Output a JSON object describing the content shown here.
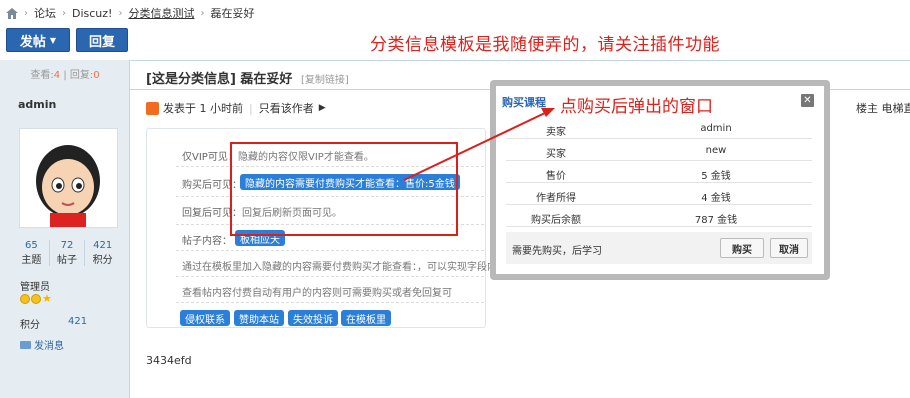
{
  "breadcrumb": {
    "items": [
      "论坛",
      "Discuz!",
      "分类信息测试",
      "磊在妥好"
    ]
  },
  "toolbar": {
    "post_label": "发帖",
    "reply_label": "回复"
  },
  "annotation_top": "分类信息模板是我随便弄的，请关注插件功能",
  "thread": {
    "views_label": "查看:",
    "views": "4",
    "sep": "|",
    "replies_label": "回复:",
    "replies": "0",
    "category": "[这是分类信息]",
    "title": "磊在妥好",
    "copy_link": "[复制链接]"
  },
  "author": {
    "name": "admin",
    "stats": [
      {
        "value": "65",
        "label": "主题"
      },
      {
        "value": "72",
        "label": "帖子"
      },
      {
        "value": "421",
        "label": "积分"
      }
    ],
    "role": "管理员",
    "points_label": "积分",
    "points_value": "421",
    "send_message": "发消息"
  },
  "post": {
    "posted": "发表于 1 小时前",
    "only_author": "只看该作者",
    "floor_right": "楼主 电梯直"
  },
  "infobox": {
    "vip_label": "仅VIP可见：",
    "vip_text": "隐藏的内容仅限VIP才能查看。",
    "buy_label": "购买后可见：",
    "buy_text": "隐藏的内容需要付费购买才能查看：售价:5金钱",
    "reply_label": "回复后可见：",
    "reply_text": "回复后刷新页面可见。",
    "content_label": "帖子内容：",
    "content_pill": "板相应天",
    "desc1": "通过在模板里加入隐藏的内容需要付费购买才能查看：，可以实现字段内",
    "desc2": "查看帖内容付费自动有用户的内容则可需要购买或者免回复可",
    "buttons": [
      "侵权联系",
      "赞助本站",
      "失效投诉",
      "在模板里"
    ]
  },
  "modal": {
    "title": "购买课程",
    "close": "✕",
    "rows": [
      {
        "key": "卖家",
        "value": "admin"
      },
      {
        "key": "买家",
        "value": "new"
      },
      {
        "key": "售价",
        "value": "5 金钱"
      },
      {
        "key": "作者所得",
        "value": "4 金钱"
      },
      {
        "key": "购买后余额",
        "value": "787 金钱"
      }
    ],
    "hint": "需要先购买，后学习",
    "buy_label": "购买",
    "cancel_label": "取消"
  },
  "annotation_popup": "点购买后弹出的窗口",
  "footer_text": "3434efd",
  "colors": {
    "accent": "#2b66b1",
    "annotation": "#e0201b",
    "pill": "#2b7fd8"
  }
}
